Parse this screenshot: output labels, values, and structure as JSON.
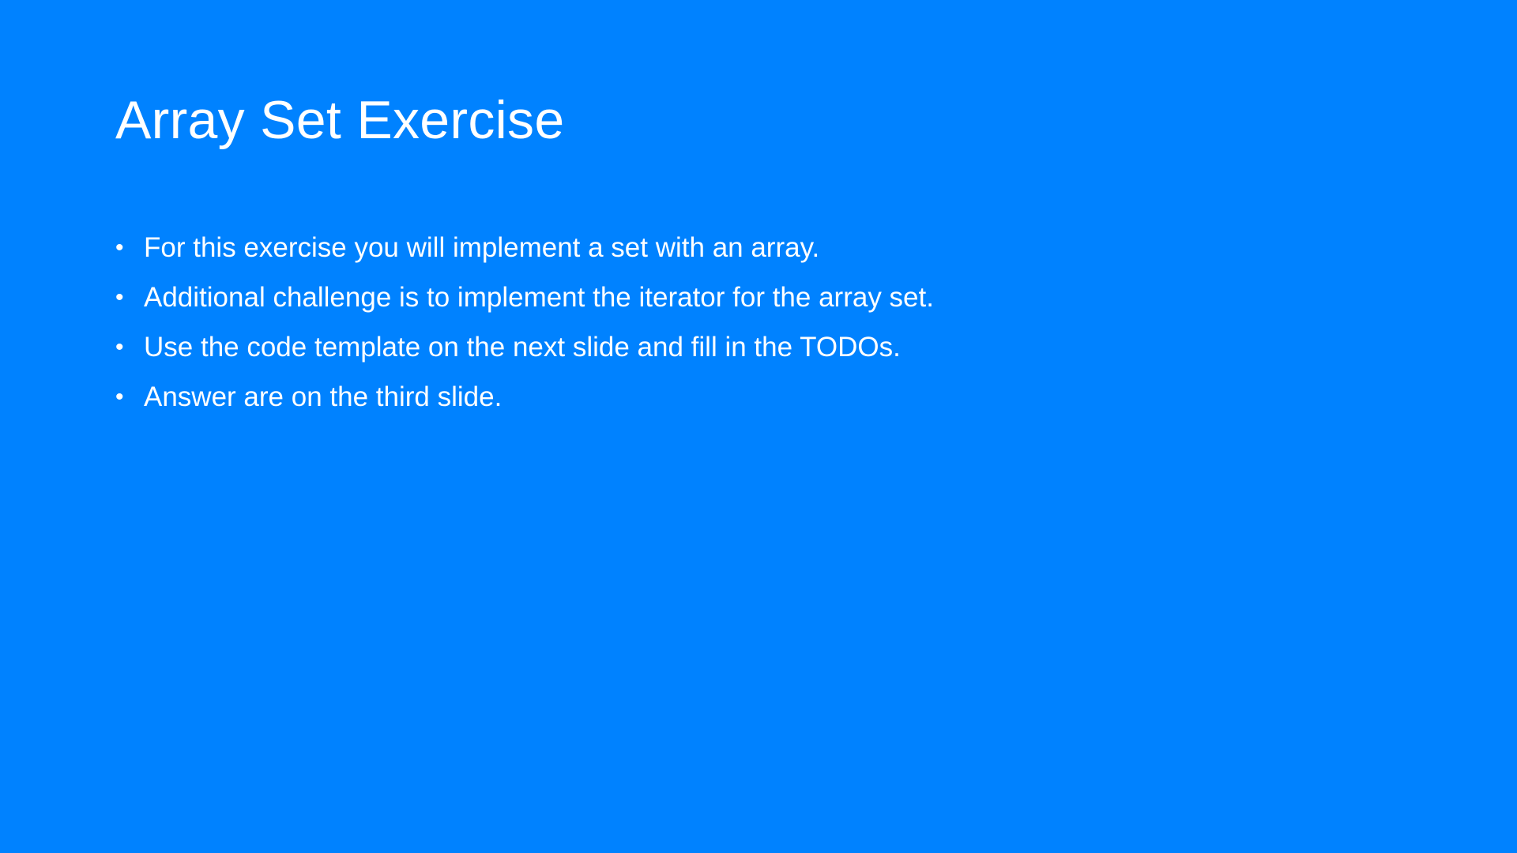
{
  "slide": {
    "title": "Array Set Exercise",
    "bullet_glyph": "•",
    "bullets": [
      "For this exercise you will implement a set with an array.",
      "Additional challenge is to implement the iterator for the array set.",
      "Use the code template on the next slide and fill in the TODOs.",
      "Answer are on the third slide."
    ]
  },
  "colors": {
    "background": "#0082FF",
    "text": "#FFFFFF"
  }
}
